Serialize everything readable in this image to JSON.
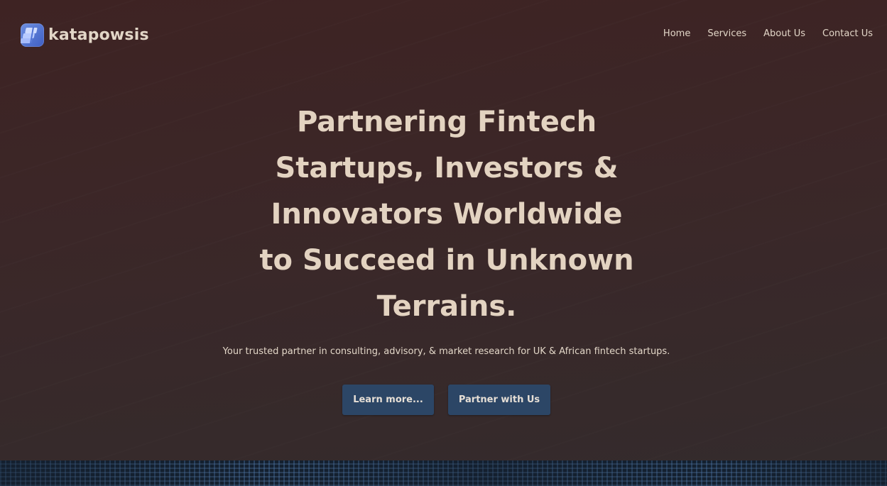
{
  "brand": {
    "name": "katapowsis",
    "logo_icon": "stacked-blocks-icon",
    "logo_color": "#4f72d4"
  },
  "nav": {
    "items": [
      {
        "label": "Home"
      },
      {
        "label": "Services"
      },
      {
        "label": "About Us"
      },
      {
        "label": "Contact Us"
      }
    ]
  },
  "hero": {
    "headline_lines": [
      "Partnering Fintech",
      "Startups, Investors &",
      "Innovators Worldwide",
      "to Succeed in Unknown",
      "Terrains."
    ],
    "subtitle": "Your trusted partner in consulting, advisory, & market research for UK & African fintech startups.",
    "buttons": {
      "learn_more": "Learn more...",
      "partner": "Partner with Us"
    }
  },
  "colors": {
    "hero_background": "#3b2626",
    "text": "#e3d3c1",
    "button": "#2c4666",
    "footer_strip": "#14202f"
  }
}
